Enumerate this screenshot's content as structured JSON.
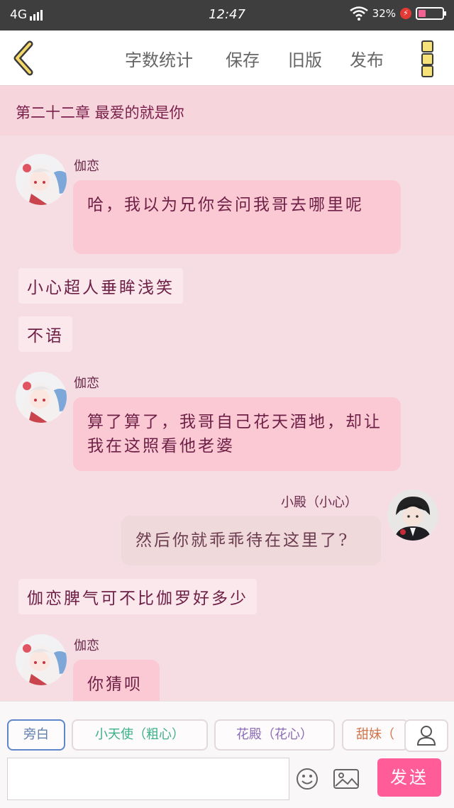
{
  "status_bar": {
    "network": "4G",
    "time": "12:47",
    "battery": "32%",
    "battery_level": 0.32
  },
  "toolbar": {
    "back_icon": "chevron-left-icon",
    "word_count": "字数统计",
    "save": "保存",
    "old_version": "旧版",
    "publish": "发布",
    "menu_icon": "more-vertical-icon"
  },
  "chapter": {
    "title": "第二十二章 最爱的就是你"
  },
  "messages": [
    {
      "type": "left",
      "name": "伽恋",
      "text": "哈，我以为兄你会问我哥去哪里呢"
    },
    {
      "type": "narration",
      "text": "小心超人垂眸浅笑"
    },
    {
      "type": "narration",
      "text": "不语"
    },
    {
      "type": "left",
      "name": "伽恋",
      "text": "算了算了，我哥自己花天酒地，却让我在这照看他老婆"
    },
    {
      "type": "right",
      "name": "小殿（小心）",
      "text": "然后你就乖乖待在这里了?"
    },
    {
      "type": "narration",
      "text": "伽恋脾气可不比伽罗好多少"
    },
    {
      "type": "left",
      "name": "伽恋",
      "text": "你猜呗"
    }
  ],
  "roles": [
    {
      "label": "旁白",
      "color": "#5f7fae",
      "active": true
    },
    {
      "label": "小天使（粗心）",
      "color": "#3db08a",
      "active": false
    },
    {
      "label": "花殿（花心）",
      "color": "#8c6bb4",
      "active": false
    },
    {
      "label": "甜妹（",
      "color": "#d2734a",
      "active": false
    }
  ],
  "composer": {
    "input_value": "",
    "send_label": "发送",
    "emoji_icon": "emoji-icon",
    "image_icon": "image-icon",
    "user_icon": "user-icon"
  }
}
